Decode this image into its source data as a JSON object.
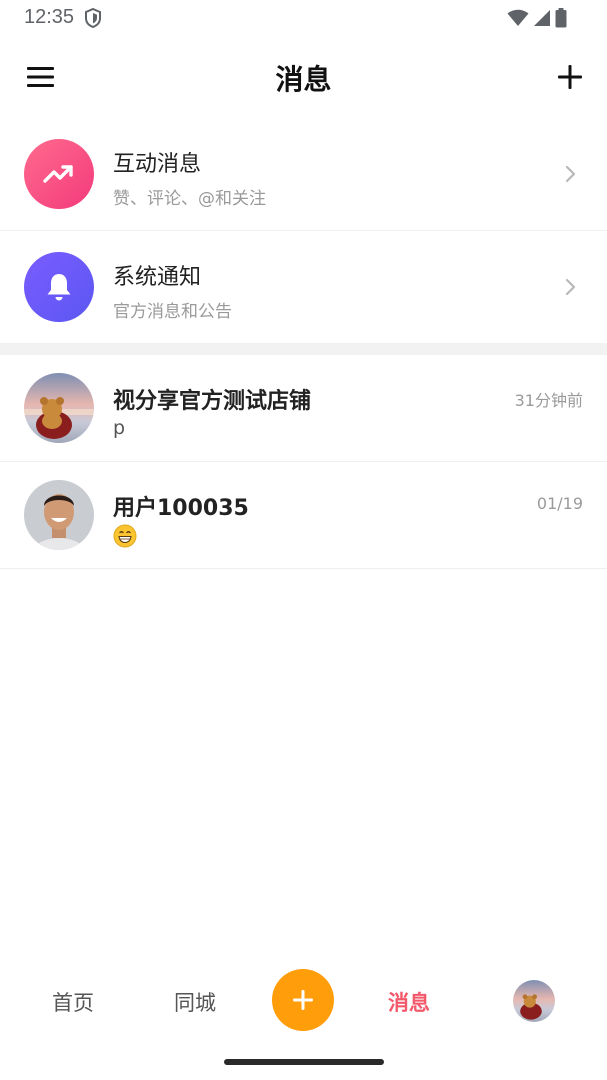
{
  "status_bar": {
    "time": "12:35",
    "icons": [
      "shield-icon",
      "wifi-icon",
      "signal-icon",
      "battery-icon"
    ]
  },
  "header": {
    "title": "消息",
    "left_icon": "menu-icon",
    "right_icon": "plus-icon"
  },
  "system_items": [
    {
      "title": "互动消息",
      "subtitle": "赞、评论、@和关注",
      "icon": "trending-up-icon",
      "color": "#f5427f"
    },
    {
      "title": "系统通知",
      "subtitle": "官方消息和公告",
      "icon": "bell-icon",
      "color": "#6a5af9"
    }
  ],
  "chats": [
    {
      "name": "视分享官方测试店铺",
      "message": "p",
      "time": "31分钟前",
      "avatar": "teddy-bear-sunset-avatar"
    },
    {
      "name": "用户100035",
      "message": "😁",
      "time": "01/19",
      "avatar": "smiling-man-avatar"
    }
  ],
  "bottom_nav": {
    "home": "首页",
    "city": "同城",
    "publish_icon": "plus-icon",
    "messages": "消息",
    "profile_icon": "profile-avatar",
    "active_color": "#f25a6b",
    "fab_color": "#ff9d0a"
  }
}
